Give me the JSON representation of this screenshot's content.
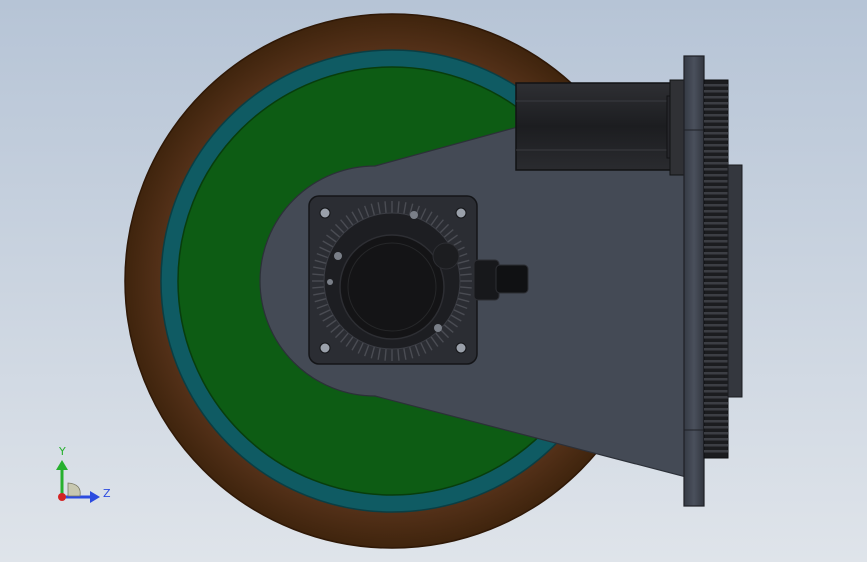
{
  "viewport": {
    "background_top": "#b6c4d6",
    "background_bottom": "#dfe4ea"
  },
  "colors": {
    "tire": "#4a2a10",
    "tire_edge": "#2f1806",
    "hub_ring": "#0f5b63",
    "hub_ring_edge": "#0a3e44",
    "rim": "#0d5c14",
    "rim_edge": "#083d0c",
    "bracket": "#444a55",
    "bracket_edge": "#2c3038",
    "motor_dark": "#1c1d20",
    "motor_mid": "#2a2b2f",
    "plate": "#3e4450",
    "gear": "#1b1c1f"
  },
  "triad": {
    "y_label": "Y",
    "z_label": "Z",
    "y_color": "#27b02f",
    "z_color": "#2c4be0",
    "x_color": "#d42424"
  }
}
